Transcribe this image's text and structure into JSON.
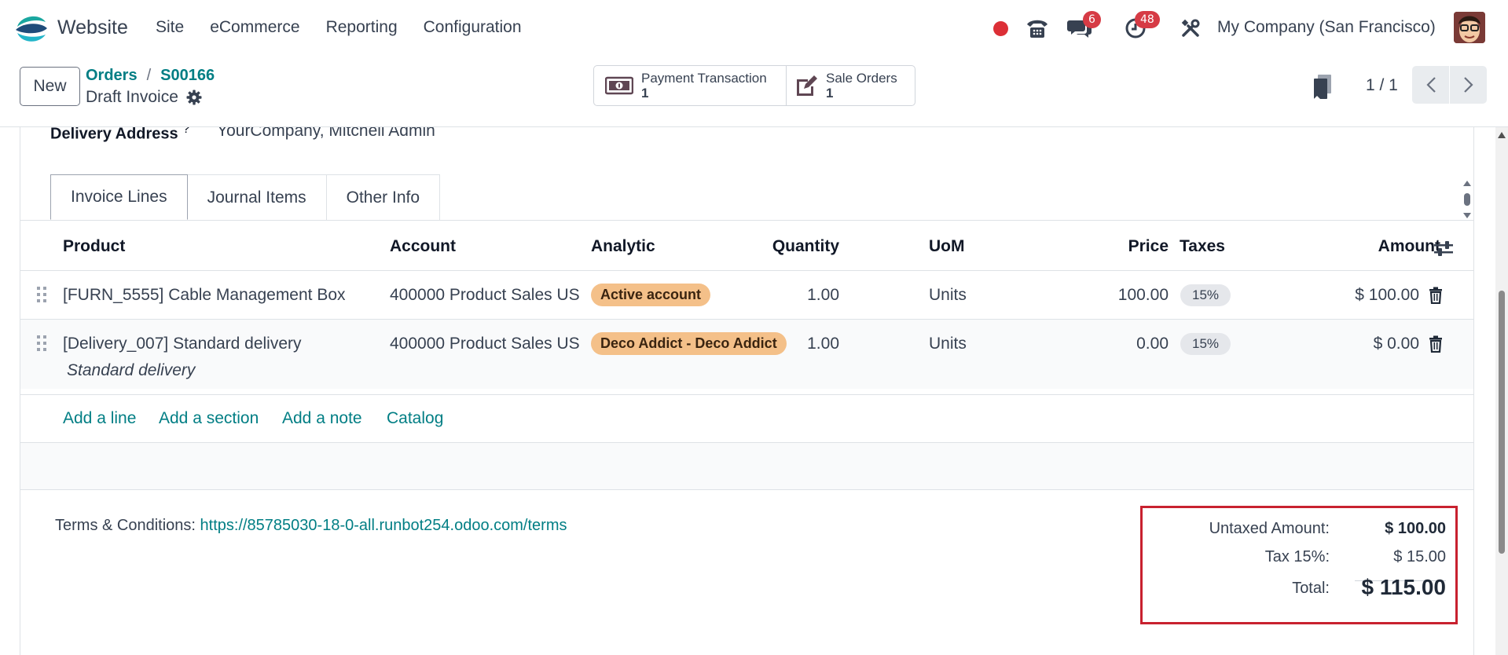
{
  "nav": {
    "app_name": "Website",
    "menu": [
      "Site",
      "eCommerce",
      "Reporting",
      "Configuration"
    ],
    "messages_count": "6",
    "activities_count": "48",
    "company": "My Company (San Francisco)"
  },
  "control": {
    "new_label": "New",
    "breadcrumb": [
      "Orders",
      "S00166"
    ],
    "breadcrumb_sep": "/",
    "record_name": "Draft Invoice",
    "smart_buttons": [
      {
        "label": "Payment Transaction",
        "count": "1",
        "icon": "money-icon"
      },
      {
        "label": "Sale Orders",
        "count": "1",
        "icon": "edit-icon"
      }
    ],
    "pager": "1 / 1"
  },
  "form": {
    "delivery_label": "Delivery Address",
    "delivery_required_mark": "?",
    "delivery_value": "YourCompany, Mitchell Admin"
  },
  "tabs": [
    "Invoice Lines",
    "Journal Items",
    "Other Info"
  ],
  "table": {
    "headers": {
      "product": "Product",
      "account": "Account",
      "analytic": "Analytic",
      "quantity": "Quantity",
      "uom": "UoM",
      "price": "Price",
      "taxes": "Taxes",
      "amount": "Amount"
    },
    "rows": [
      {
        "product": "[FURN_5555] Cable Management Box",
        "description": "",
        "account": "400000 Product Sales US",
        "analytic": "Active account",
        "quantity": "1.00",
        "uom": "Units",
        "price": "100.00",
        "taxes": "15%",
        "amount": "$ 100.00"
      },
      {
        "product": "[Delivery_007] Standard delivery",
        "description": "Standard delivery",
        "account": "400000 Product Sales US",
        "analytic": "Deco Addict - Deco Addict",
        "quantity": "1.00",
        "uom": "Units",
        "price": "0.00",
        "taxes": "15%",
        "amount": "$ 0.00"
      }
    ],
    "add_links": [
      "Add a line",
      "Add a section",
      "Add a note",
      "Catalog"
    ]
  },
  "terms": {
    "label": "Terms & Conditions:",
    "url": "https://85785030-18-0-all.runbot254.odoo.com/terms"
  },
  "totals": {
    "untaxed_label": "Untaxed Amount:",
    "untaxed_value": "$ 100.00",
    "tax_label": "Tax 15%:",
    "tax_value": "$ 15.00",
    "total_label": "Total:",
    "total_value": "$ 115.00"
  },
  "colors": {
    "accent": "#017e84",
    "highlight_border": "#c8212f",
    "badge": "#d63b45",
    "analytic_tag": "#f4c089"
  }
}
